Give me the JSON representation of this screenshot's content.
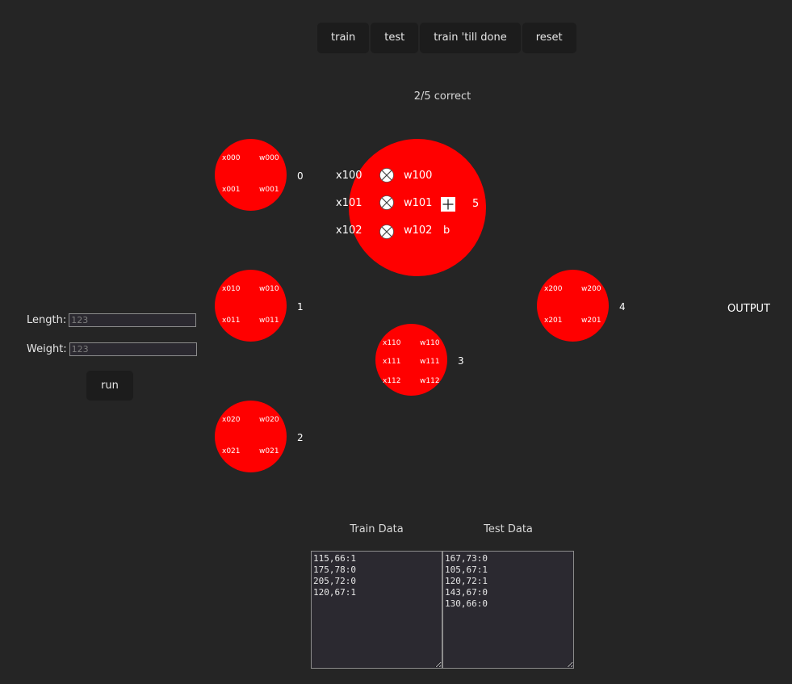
{
  "toolbar": {
    "train_label": "train",
    "test_label": "test",
    "train_till_done_label": "train 'till done",
    "reset_label": "reset"
  },
  "status": {
    "text": "2/5 correct"
  },
  "colors": {
    "background": "#252525",
    "node": "#ff0000",
    "button": "#1c1c1c",
    "textarea_bg": "#2b2930"
  },
  "inputs": {
    "length": {
      "label": "Length:",
      "placeholder": "123"
    },
    "weight": {
      "label": "Weight:",
      "placeholder": "123"
    },
    "run_label": "run"
  },
  "network": {
    "nodes": [
      {
        "index": "0",
        "inputs": [
          "x000",
          "x001"
        ],
        "weights": [
          "w000",
          "w001"
        ]
      },
      {
        "index": "1",
        "inputs": [
          "x010",
          "x011"
        ],
        "weights": [
          "w010",
          "w011"
        ]
      },
      {
        "index": "2",
        "inputs": [
          "x020",
          "x021"
        ],
        "weights": [
          "w020",
          "w021"
        ]
      },
      {
        "index": "3",
        "inputs": [
          "x110",
          "x111",
          "x112"
        ],
        "weights": [
          "w110",
          "w111",
          "w112"
        ]
      },
      {
        "index": "4",
        "inputs": [
          "x200",
          "x201"
        ],
        "weights": [
          "w200",
          "w201"
        ]
      }
    ],
    "expanded": {
      "index": "5",
      "inputs": [
        "x100",
        "x101",
        "x102"
      ],
      "weights": [
        "w100",
        "w101",
        "w102"
      ],
      "bias": "b",
      "multiply_icon": "circle-times-icon",
      "sum_icon": "square-plus-icon"
    },
    "output_label": "OUTPUT"
  },
  "data": {
    "train_heading": "Train Data",
    "test_heading": "Test Data",
    "train_text": "115,66:1\n175,78:0\n205,72:0\n120,67:1",
    "test_text": "167,73:0\n105,67:1\n120,72:1\n143,67:0\n130,66:0"
  }
}
